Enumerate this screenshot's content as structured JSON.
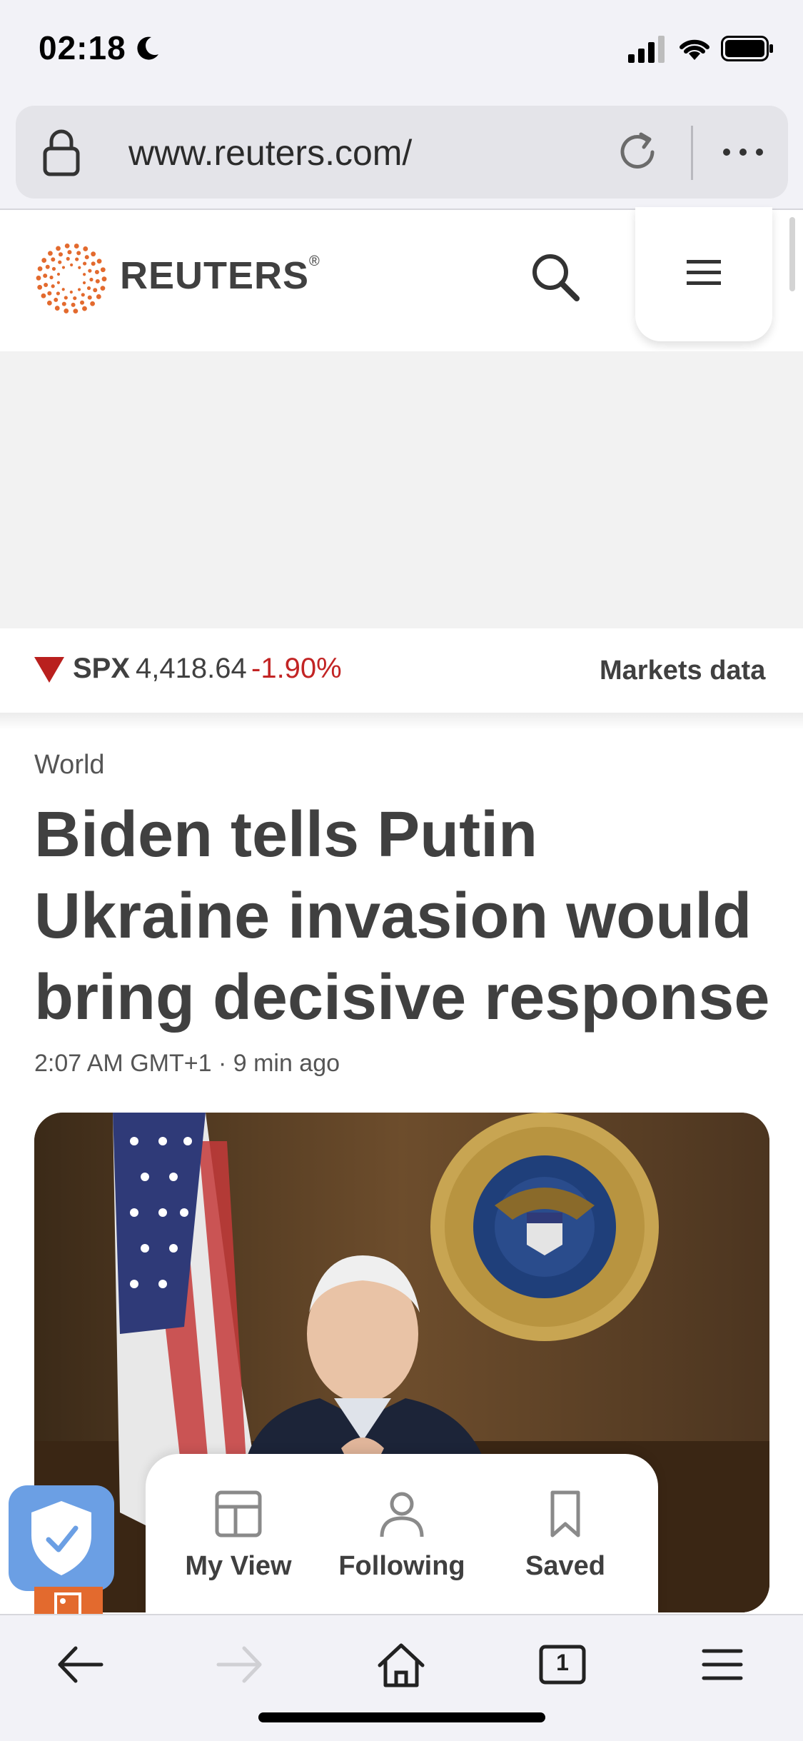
{
  "status_bar": {
    "time": "02:18",
    "icons": [
      "moon-icon",
      "signal-icon",
      "wifi-icon",
      "battery-icon"
    ]
  },
  "browser": {
    "url": "www.reuters.com/",
    "icons": [
      "lock-icon",
      "reload-icon",
      "more-icon"
    ]
  },
  "site": {
    "brand": "REUTERS",
    "brand_mark": "®",
    "brand_color": "#e36a2e",
    "icons": [
      "search-icon",
      "menu-icon"
    ]
  },
  "ticker": {
    "symbol": "SPX",
    "value": "4,418.64",
    "change": "-1.90%",
    "direction": "down",
    "down_color": "#b9201e",
    "markets_link": "Markets data"
  },
  "article": {
    "section": "World",
    "headline": "Biden tells Putin Ukraine invasion would bring decisive response",
    "timestamp": "2:07 AM GMT+1 · 9 min ago"
  },
  "floating_nav": {
    "items": [
      {
        "label": "My View",
        "icon": "layout-icon"
      },
      {
        "label": "Following",
        "icon": "person-icon"
      },
      {
        "label": "Saved",
        "icon": "bookmark-icon"
      }
    ]
  },
  "toolbar": {
    "tab_count": "1",
    "icons": [
      "back-icon",
      "forward-icon",
      "home-icon",
      "tabs-icon",
      "menu-icon"
    ]
  }
}
